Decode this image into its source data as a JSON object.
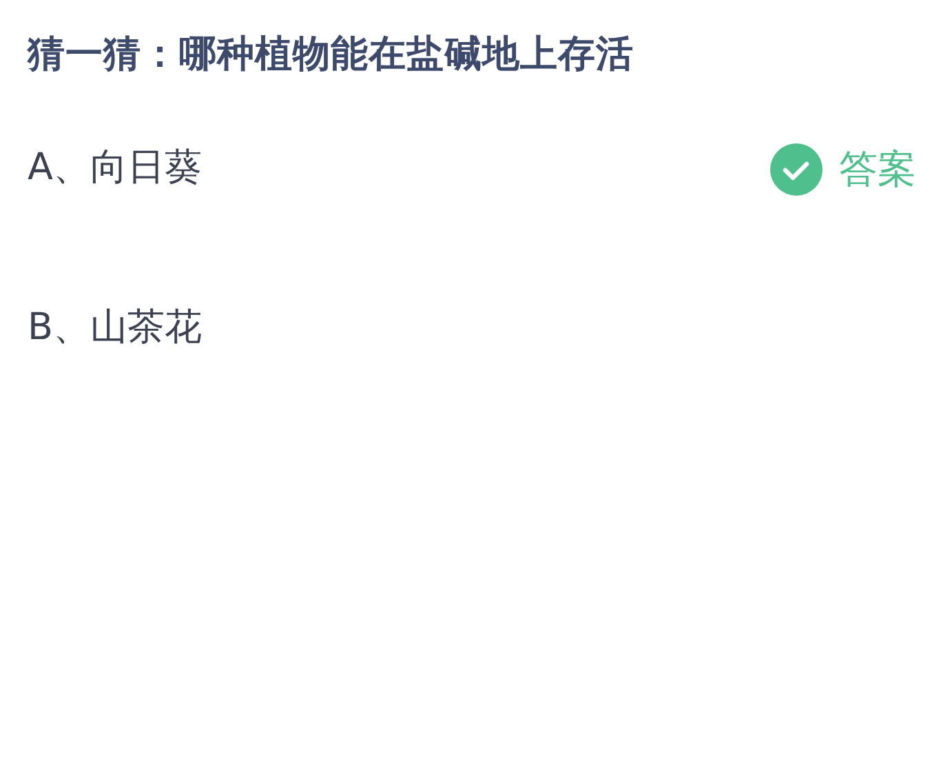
{
  "title": "猜一猜：哪种植物能在盐碱地上存活",
  "options": [
    {
      "label": "A、向日葵",
      "correct": true
    },
    {
      "label": "B、山茶花",
      "correct": false
    }
  ],
  "answer_tag": "答案"
}
